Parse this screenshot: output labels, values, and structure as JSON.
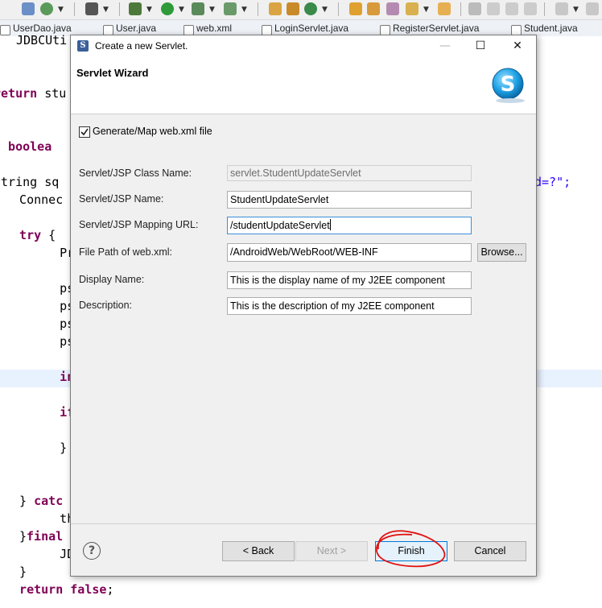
{
  "editor_tabs": [
    "UserDao.java",
    "User.java",
    "web.xml",
    "LoginServlet.java",
    "RegisterServlet.java",
    "Student.java"
  ],
  "code_lines": {
    "l1": "JDBCUti",
    "l2_kw": "return",
    "l2_rest": " stu",
    "l3_rest": "c boolea",
    "l4": "String sq",
    "l4_right": "d=?\";",
    "l5": "  Connec",
    "l6_kw": "  try",
    "l6_rest": " {",
    "l7": "      Pr",
    "l8": "      ps",
    "l9": "      ps",
    "l10": "      ps",
    "l11": "      ps",
    "l12_kw": "      in",
    "l13_kw": "      if",
    "l14": "      }",
    "l15_rest": "  } ",
    "l15_kw": "catc",
    "l16": "      th",
    "l17_rest": "}",
    "l17_kw": "final",
    "l18": "      JD",
    "l19": "  }",
    "l20_kw": "  return false",
    "l20_rest": ";"
  },
  "dialog": {
    "title": "Create a new Servlet.",
    "banner_title": "Servlet Wizard",
    "minimize": "—",
    "maximize": "☐",
    "close": "✕",
    "checkbox_label": "Generate/Map web.xml file",
    "checkbox_checked": true,
    "fields": {
      "class_name_label": "Servlet/JSP Class Name:",
      "class_name_value": "servlet.StudentUpdateServlet",
      "name_label": "Servlet/JSP Name:",
      "name_value": "StudentUpdateServlet",
      "mapping_label": "Servlet/JSP Mapping URL:",
      "mapping_value": "/studentUpdateServlet",
      "filepath_label": "File Path of web.xml:",
      "filepath_value": "/AndroidWeb/WebRoot/WEB-INF",
      "display_label": "Display Name:",
      "display_value": "This is the display name of my J2EE component",
      "description_label": "Description:",
      "description_value": "This is the description of my J2EE component"
    },
    "browse_label": "Browse...",
    "back_label": "< Back",
    "next_label": "Next >",
    "finish_label": "Finish",
    "cancel_label": "Cancel",
    "help_label": "?"
  }
}
